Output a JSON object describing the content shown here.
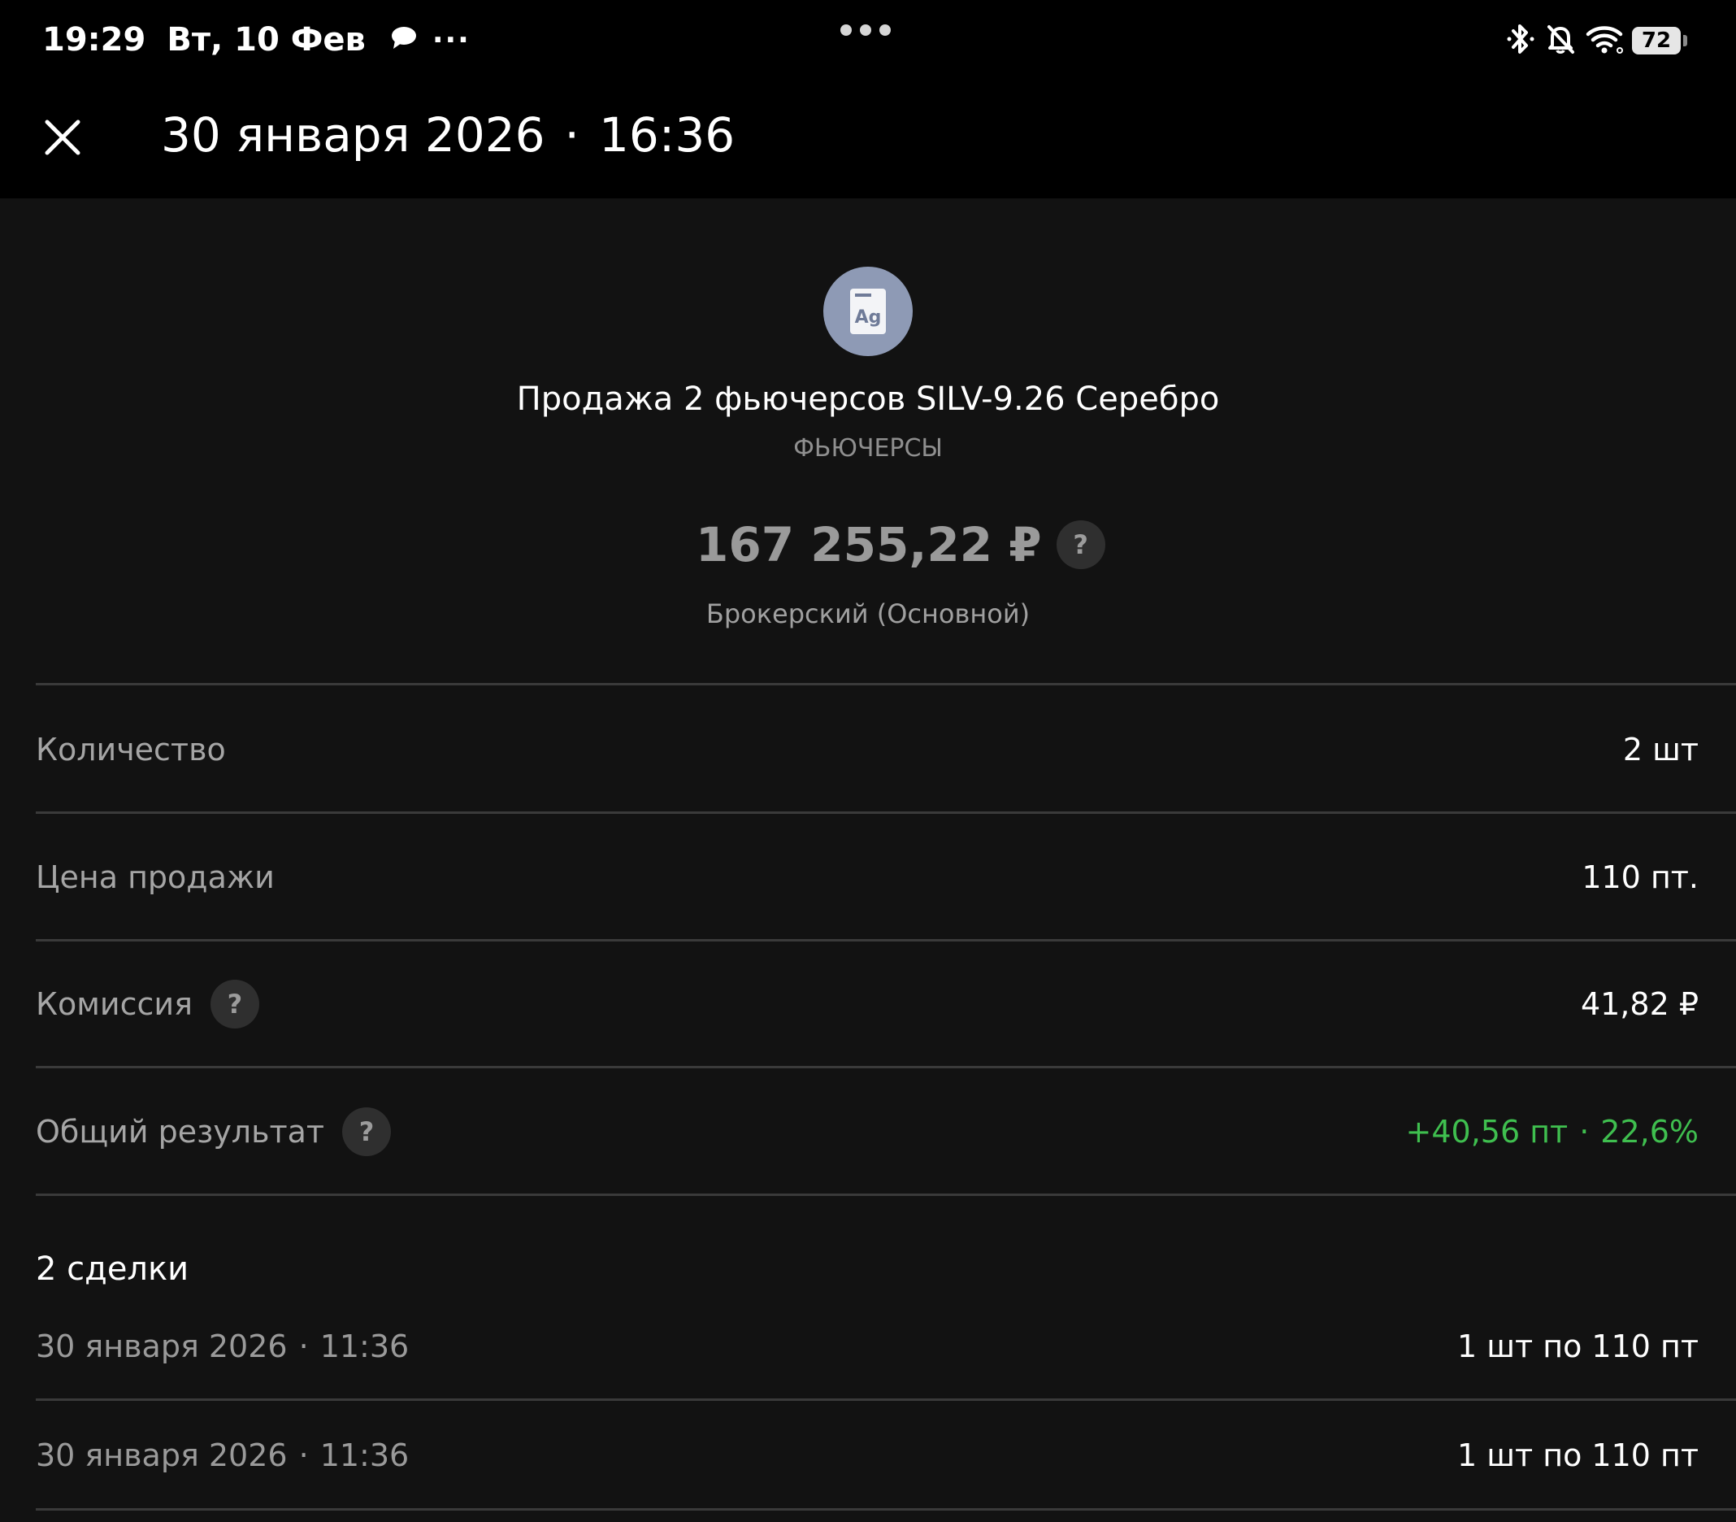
{
  "status_bar": {
    "time": "19:29",
    "date": "Вт, 10 Фев",
    "overflow": "···",
    "battery": "72",
    "icons": [
      "message-icon",
      "bluetooth-icon",
      "bell-off-icon",
      "wifi-icon",
      "battery-icon"
    ]
  },
  "header": {
    "date": "30 января 2026",
    "separator": "·",
    "time": "16:36"
  },
  "operation": {
    "icon_text": "Ag",
    "title": "Продажа 2 фьючерсов SILV-9.26 Серебро",
    "category": "ФЬЮЧЕРСЫ",
    "amount": "167 255,22 ₽",
    "help": "?",
    "account": "Брокерский (Основной)"
  },
  "details": [
    {
      "label": "Количество",
      "value": "2 шт",
      "help": null
    },
    {
      "label": "Цена продажи",
      "value": "110 пт.",
      "help": null
    },
    {
      "label": "Комиссия",
      "value": "41,82 ₽",
      "help": "?"
    },
    {
      "label": "Общий результат",
      "value_main": "+40,56 пт",
      "separator": "·",
      "value_pct": "22,6%",
      "help": "?"
    }
  ],
  "deals": {
    "title": "2 сделки",
    "items": [
      {
        "date": "30 января 2026",
        "separator": "·",
        "time": "11:36",
        "qty": "1 шт по 110 пт"
      },
      {
        "date": "30 января 2026",
        "separator": "·",
        "time": "11:36",
        "qty": "1 шт по 110 пт"
      }
    ]
  },
  "colors": {
    "background": "#121212",
    "header_background": "#000000",
    "positive": "#3fbf4f",
    "icon_circle": "#8e9ab5"
  }
}
